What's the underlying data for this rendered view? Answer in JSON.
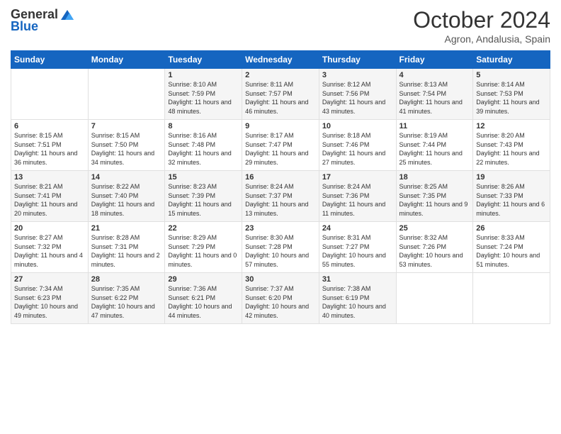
{
  "logo": {
    "general": "General",
    "blue": "Blue"
  },
  "title": "October 2024",
  "subtitle": "Agron, Andalusia, Spain",
  "days_of_week": [
    "Sunday",
    "Monday",
    "Tuesday",
    "Wednesday",
    "Thursday",
    "Friday",
    "Saturday"
  ],
  "weeks": [
    [
      {
        "day": "",
        "sunrise": "",
        "sunset": "",
        "daylight": ""
      },
      {
        "day": "",
        "sunrise": "",
        "sunset": "",
        "daylight": ""
      },
      {
        "day": "1",
        "sunrise": "Sunrise: 8:10 AM",
        "sunset": "Sunset: 7:59 PM",
        "daylight": "Daylight: 11 hours and 48 minutes."
      },
      {
        "day": "2",
        "sunrise": "Sunrise: 8:11 AM",
        "sunset": "Sunset: 7:57 PM",
        "daylight": "Daylight: 11 hours and 46 minutes."
      },
      {
        "day": "3",
        "sunrise": "Sunrise: 8:12 AM",
        "sunset": "Sunset: 7:56 PM",
        "daylight": "Daylight: 11 hours and 43 minutes."
      },
      {
        "day": "4",
        "sunrise": "Sunrise: 8:13 AM",
        "sunset": "Sunset: 7:54 PM",
        "daylight": "Daylight: 11 hours and 41 minutes."
      },
      {
        "day": "5",
        "sunrise": "Sunrise: 8:14 AM",
        "sunset": "Sunset: 7:53 PM",
        "daylight": "Daylight: 11 hours and 39 minutes."
      }
    ],
    [
      {
        "day": "6",
        "sunrise": "Sunrise: 8:15 AM",
        "sunset": "Sunset: 7:51 PM",
        "daylight": "Daylight: 11 hours and 36 minutes."
      },
      {
        "day": "7",
        "sunrise": "Sunrise: 8:15 AM",
        "sunset": "Sunset: 7:50 PM",
        "daylight": "Daylight: 11 hours and 34 minutes."
      },
      {
        "day": "8",
        "sunrise": "Sunrise: 8:16 AM",
        "sunset": "Sunset: 7:48 PM",
        "daylight": "Daylight: 11 hours and 32 minutes."
      },
      {
        "day": "9",
        "sunrise": "Sunrise: 8:17 AM",
        "sunset": "Sunset: 7:47 PM",
        "daylight": "Daylight: 11 hours and 29 minutes."
      },
      {
        "day": "10",
        "sunrise": "Sunrise: 8:18 AM",
        "sunset": "Sunset: 7:46 PM",
        "daylight": "Daylight: 11 hours and 27 minutes."
      },
      {
        "day": "11",
        "sunrise": "Sunrise: 8:19 AM",
        "sunset": "Sunset: 7:44 PM",
        "daylight": "Daylight: 11 hours and 25 minutes."
      },
      {
        "day": "12",
        "sunrise": "Sunrise: 8:20 AM",
        "sunset": "Sunset: 7:43 PM",
        "daylight": "Daylight: 11 hours and 22 minutes."
      }
    ],
    [
      {
        "day": "13",
        "sunrise": "Sunrise: 8:21 AM",
        "sunset": "Sunset: 7:41 PM",
        "daylight": "Daylight: 11 hours and 20 minutes."
      },
      {
        "day": "14",
        "sunrise": "Sunrise: 8:22 AM",
        "sunset": "Sunset: 7:40 PM",
        "daylight": "Daylight: 11 hours and 18 minutes."
      },
      {
        "day": "15",
        "sunrise": "Sunrise: 8:23 AM",
        "sunset": "Sunset: 7:39 PM",
        "daylight": "Daylight: 11 hours and 15 minutes."
      },
      {
        "day": "16",
        "sunrise": "Sunrise: 8:24 AM",
        "sunset": "Sunset: 7:37 PM",
        "daylight": "Daylight: 11 hours and 13 minutes."
      },
      {
        "day": "17",
        "sunrise": "Sunrise: 8:24 AM",
        "sunset": "Sunset: 7:36 PM",
        "daylight": "Daylight: 11 hours and 11 minutes."
      },
      {
        "day": "18",
        "sunrise": "Sunrise: 8:25 AM",
        "sunset": "Sunset: 7:35 PM",
        "daylight": "Daylight: 11 hours and 9 minutes."
      },
      {
        "day": "19",
        "sunrise": "Sunrise: 8:26 AM",
        "sunset": "Sunset: 7:33 PM",
        "daylight": "Daylight: 11 hours and 6 minutes."
      }
    ],
    [
      {
        "day": "20",
        "sunrise": "Sunrise: 8:27 AM",
        "sunset": "Sunset: 7:32 PM",
        "daylight": "Daylight: 11 hours and 4 minutes."
      },
      {
        "day": "21",
        "sunrise": "Sunrise: 8:28 AM",
        "sunset": "Sunset: 7:31 PM",
        "daylight": "Daylight: 11 hours and 2 minutes."
      },
      {
        "day": "22",
        "sunrise": "Sunrise: 8:29 AM",
        "sunset": "Sunset: 7:29 PM",
        "daylight": "Daylight: 11 hours and 0 minutes."
      },
      {
        "day": "23",
        "sunrise": "Sunrise: 8:30 AM",
        "sunset": "Sunset: 7:28 PM",
        "daylight": "Daylight: 10 hours and 57 minutes."
      },
      {
        "day": "24",
        "sunrise": "Sunrise: 8:31 AM",
        "sunset": "Sunset: 7:27 PM",
        "daylight": "Daylight: 10 hours and 55 minutes."
      },
      {
        "day": "25",
        "sunrise": "Sunrise: 8:32 AM",
        "sunset": "Sunset: 7:26 PM",
        "daylight": "Daylight: 10 hours and 53 minutes."
      },
      {
        "day": "26",
        "sunrise": "Sunrise: 8:33 AM",
        "sunset": "Sunset: 7:24 PM",
        "daylight": "Daylight: 10 hours and 51 minutes."
      }
    ],
    [
      {
        "day": "27",
        "sunrise": "Sunrise: 7:34 AM",
        "sunset": "Sunset: 6:23 PM",
        "daylight": "Daylight: 10 hours and 49 minutes."
      },
      {
        "day": "28",
        "sunrise": "Sunrise: 7:35 AM",
        "sunset": "Sunset: 6:22 PM",
        "daylight": "Daylight: 10 hours and 47 minutes."
      },
      {
        "day": "29",
        "sunrise": "Sunrise: 7:36 AM",
        "sunset": "Sunset: 6:21 PM",
        "daylight": "Daylight: 10 hours and 44 minutes."
      },
      {
        "day": "30",
        "sunrise": "Sunrise: 7:37 AM",
        "sunset": "Sunset: 6:20 PM",
        "daylight": "Daylight: 10 hours and 42 minutes."
      },
      {
        "day": "31",
        "sunrise": "Sunrise: 7:38 AM",
        "sunset": "Sunset: 6:19 PM",
        "daylight": "Daylight: 10 hours and 40 minutes."
      },
      {
        "day": "",
        "sunrise": "",
        "sunset": "",
        "daylight": ""
      },
      {
        "day": "",
        "sunrise": "",
        "sunset": "",
        "daylight": ""
      }
    ]
  ]
}
